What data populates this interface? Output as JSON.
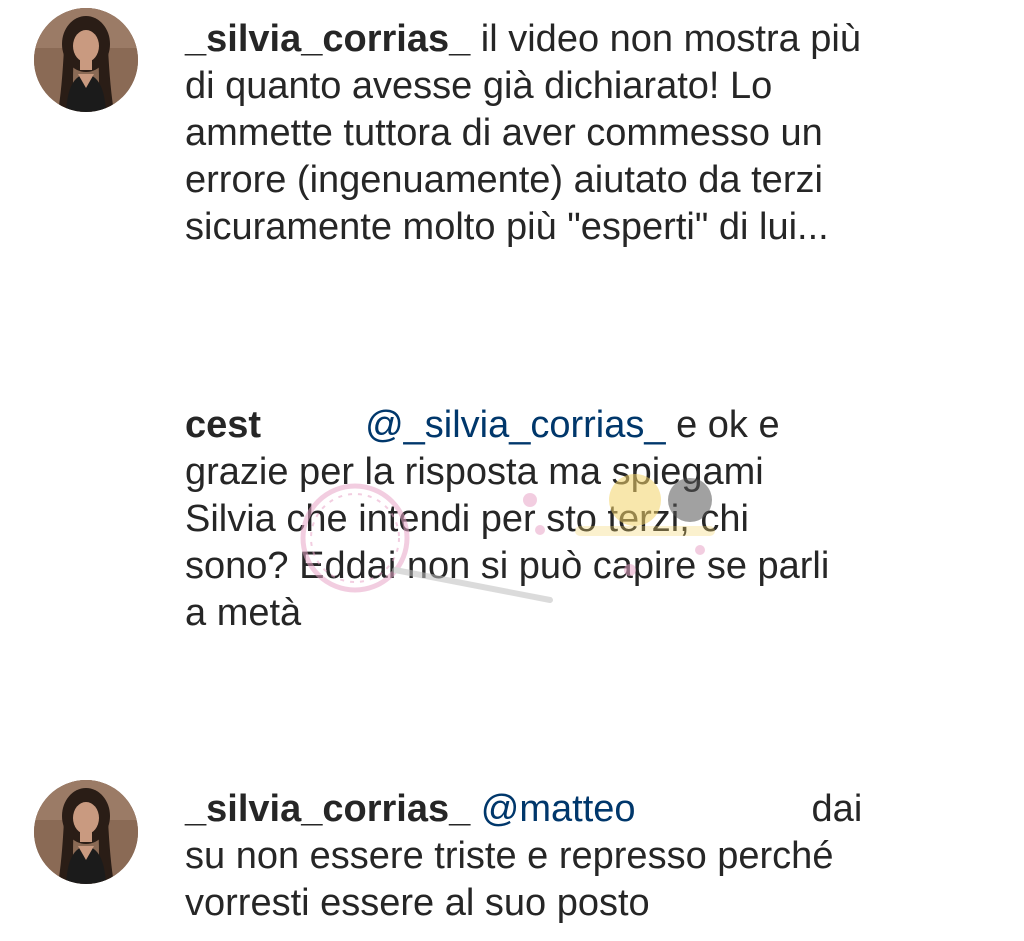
{
  "comments": [
    {
      "username": "_silvia_corrias_",
      "mention": "",
      "text": "il video non mostra più\ndi quanto avesse già dichiarato! Lo\nammette tuttora di aver commesso un\nerrore (ingenuamente) aiutato da terzi\nsicuramente molto più \"esperti\" di lui...",
      "has_avatar": true,
      "avatar_icon": "profile-photo"
    },
    {
      "username": "cest",
      "mention": "@_silvia_corrias_",
      "text": "e ok e\ngrazie per la risposta ma spiegami\nSilvia che intendi per sto terzi, chi\nsono? Eddai non si può capire se parli\na metà",
      "has_avatar": false
    },
    {
      "username": "_silvia_corrias_",
      "mention": "@matteo",
      "text": "dai\nsu non essere triste e represso perché\nvorresti essere al suo posto",
      "has_avatar": true,
      "avatar_icon": "profile-photo"
    }
  ],
  "watermark": {
    "icon": "watermark-logo",
    "colors": {
      "ring": "#e8a6c8",
      "accent": "#f4d46a"
    }
  },
  "colors": {
    "text": "#262626",
    "mention": "#00376b",
    "background": "#ffffff"
  }
}
